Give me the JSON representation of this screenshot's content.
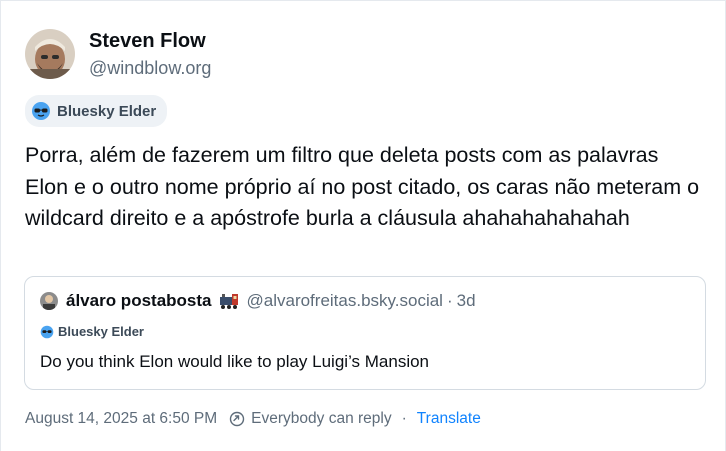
{
  "post": {
    "author": {
      "display_name": "Steven Flow",
      "handle": "@windblow.org",
      "badge": "Bluesky Elder"
    },
    "text": "Porra, além de fazerem um filtro que deleta posts com as palavras Elon e o outro nome próprio aí no post citado, os caras não meteram o wildcard direito e a apóstrofe burla a cláusula ahahahahahahah",
    "quote": {
      "author_name": "álvaro postabosta",
      "author_emoji": "train-icon",
      "handle": "@alvarofreitas.bsky.social",
      "separator": "·",
      "time": "3d",
      "badge": "Bluesky Elder",
      "text": "Do you think Elon would like to play Luigi’s Mansion"
    },
    "meta": {
      "timestamp": "August 14, 2025 at 6:50 PM",
      "reply_setting": "Everybody can reply",
      "separator": "·",
      "translate_label": "Translate"
    }
  },
  "colors": {
    "text": "#0b0f14",
    "secondary": "#5e6c7a",
    "badge_bg": "#eef2f6",
    "border": "#d4dbe2",
    "link": "#1083fe"
  }
}
